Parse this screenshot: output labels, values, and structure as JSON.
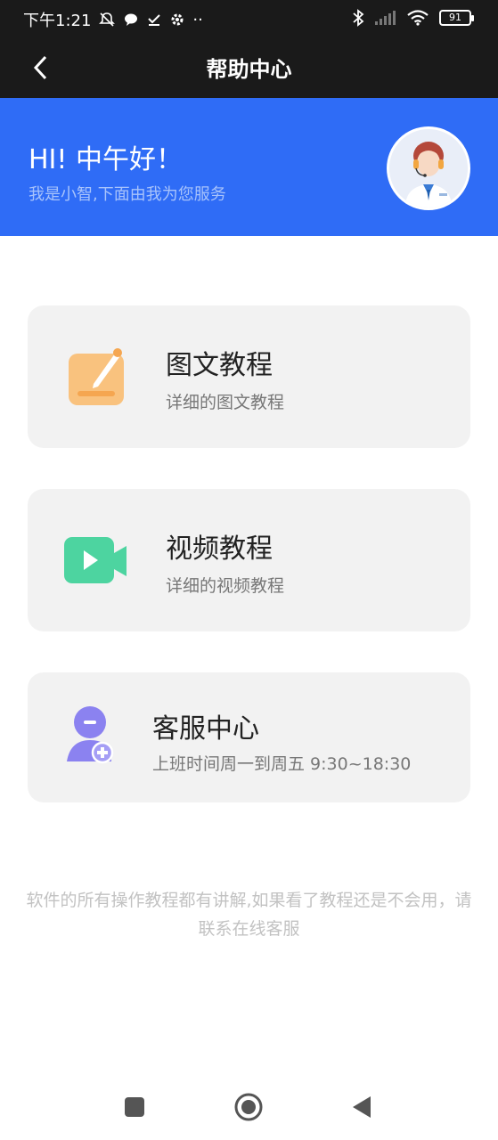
{
  "status_bar": {
    "time": "下午1:21",
    "dots": "··",
    "battery": "91"
  },
  "nav": {
    "title": "帮助中心",
    "back_icon": "chevron-left-icon"
  },
  "banner": {
    "greeting": "HI! 中午好！",
    "subtitle": "我是小智,下面由我为您服务",
    "background": "#2f6cf6"
  },
  "cards": [
    {
      "title": "图文教程",
      "desc": "详细的图文教程",
      "icon": "edit-document-icon",
      "icon_color": "#f9c27e"
    },
    {
      "title": "视频教程",
      "desc": "详细的视频教程",
      "icon": "video-camera-icon",
      "icon_color": "#4dd4a0"
    },
    {
      "title": "客服中心",
      "desc": "上班时间周一到周五 9:30~18:30",
      "icon": "customer-service-icon",
      "icon_color": "#8b82f0"
    }
  ],
  "footer_note": "软件的所有操作教程都有讲解,如果看了教程还是不会用，请联系在线客服"
}
